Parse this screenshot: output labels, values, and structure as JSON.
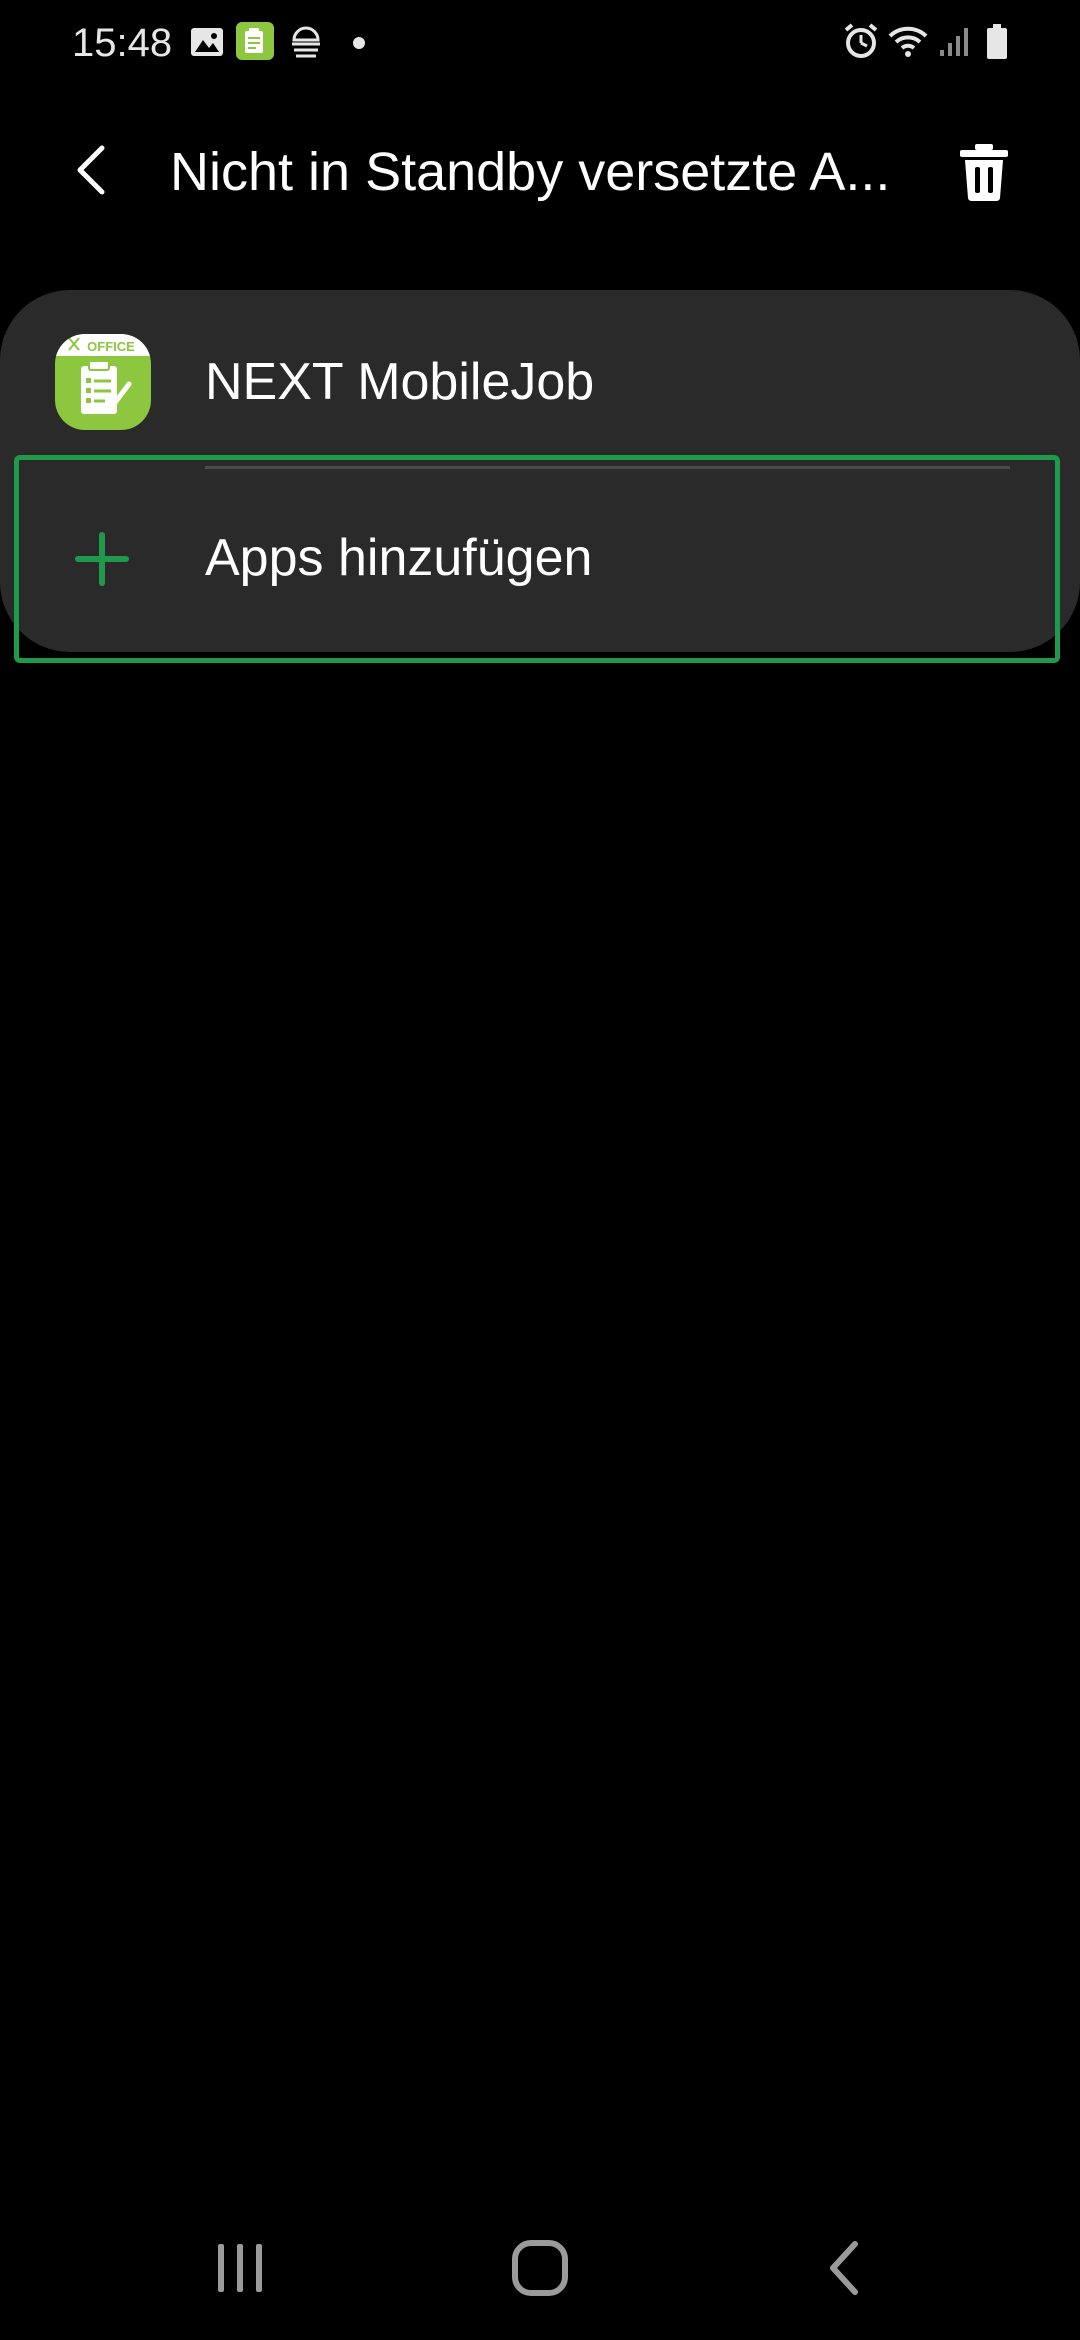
{
  "status_bar": {
    "time": "15:48",
    "left_icons": [
      "gallery-icon",
      "next-mobilejob-notification-icon",
      "dex-icon",
      "dot-icon"
    ],
    "right_icons": [
      "alarm-icon",
      "wifi-icon",
      "signal-icon",
      "battery-icon"
    ]
  },
  "app_bar": {
    "title": "Nicht in Standby versetzte A...",
    "back_icon": "chevron-left-icon",
    "delete_icon": "trash-icon"
  },
  "list": {
    "apps": [
      {
        "name": "NEXT MobileJob",
        "icon": "next-mobilejob-app-icon",
        "icon_text": "OFFICE"
      }
    ],
    "add_action": {
      "label": "Apps hinzufügen",
      "icon": "plus-icon"
    }
  },
  "nav_bar": {
    "buttons": [
      "recent-apps-icon",
      "home-icon",
      "back-icon"
    ]
  },
  "colors": {
    "background": "#000000",
    "card": "#2a2a2a",
    "accent": "#1f9a4b",
    "app_icon": "#8dc63f"
  }
}
